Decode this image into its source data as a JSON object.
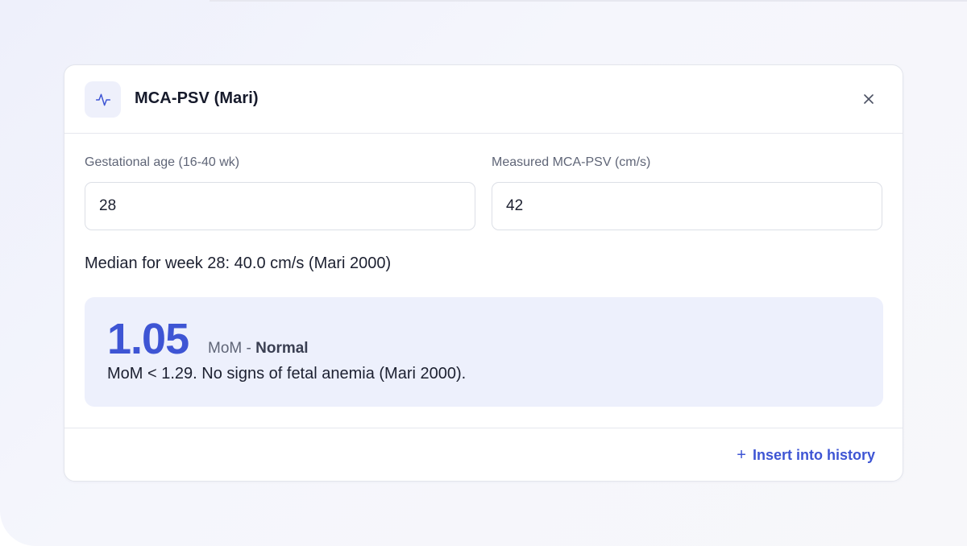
{
  "card": {
    "title": "MCA-PSV (Mari)",
    "header_icon": "pulse-icon",
    "close_icon": "close-icon"
  },
  "fields": {
    "gestational_age": {
      "label": "Gestational age (16-40 wk)",
      "value": "28"
    },
    "measured_psv": {
      "label": "Measured MCA-PSV (cm/s)",
      "value": "42"
    }
  },
  "median_text": "Median for week 28: 40.0 cm/s (Mari 2000)",
  "result": {
    "value": "1.05",
    "unit": "MoM",
    "separator": "-",
    "status": "Normal",
    "description": "MoM < 1.29. No signs of fetal anemia (Mari 2000)."
  },
  "footer": {
    "insert_plus": "+",
    "insert_label": "Insert into history"
  },
  "colors": {
    "accent": "#3e55d4",
    "result_background": "#edf0fc",
    "icon_background": "#eef0fb"
  }
}
